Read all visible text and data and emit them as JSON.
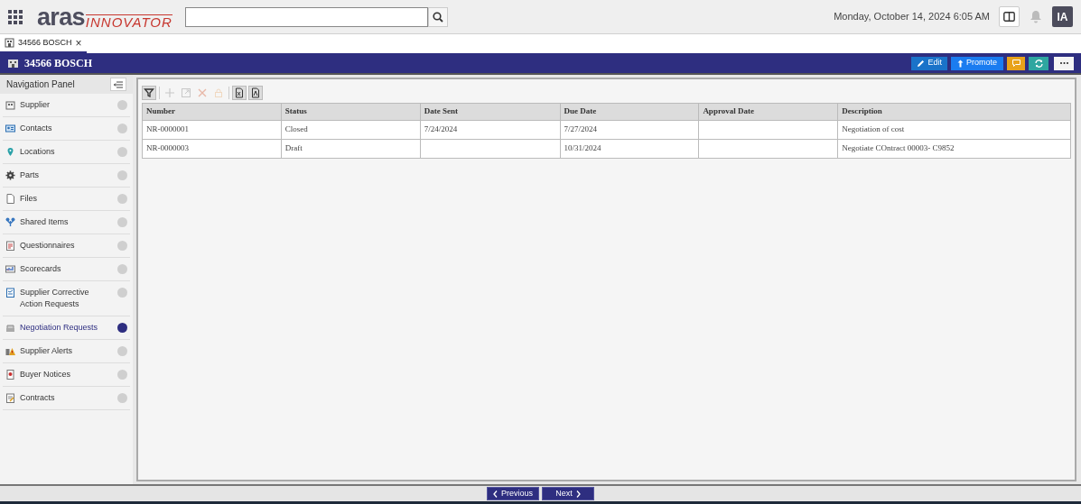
{
  "header": {
    "logo_main": "aras",
    "logo_sub": "INNOVATOR",
    "datetime": "Monday, October 14, 2024 6:05 AM",
    "avatar": "IA"
  },
  "tabs": [
    {
      "label": "34566 BOSCH",
      "selected": true,
      "close": "×"
    }
  ],
  "item_bar": {
    "title": "34566 BOSCH",
    "buttons": [
      {
        "kind": "edit",
        "label": "Edit"
      },
      {
        "kind": "promote",
        "label": "Promote"
      },
      {
        "kind": "comment"
      },
      {
        "kind": "refresh"
      },
      {
        "kind": "more"
      }
    ]
  },
  "navigation": {
    "title": "Navigation Panel",
    "items": [
      {
        "label": "Supplier",
        "selected": false
      },
      {
        "label": "Contacts",
        "selected": false
      },
      {
        "label": "Locations",
        "selected": false
      },
      {
        "label": "Parts",
        "selected": false
      },
      {
        "label": "Files",
        "selected": false
      },
      {
        "label": "Shared Items",
        "selected": false
      },
      {
        "label": "Questionnaires",
        "selected": false
      },
      {
        "label": "Scorecards",
        "selected": false
      },
      {
        "label": "Supplier Corrective Action Requests",
        "selected": false
      },
      {
        "label": "Negotiation Requests",
        "selected": true
      },
      {
        "label": "Supplier Alerts",
        "selected": false
      },
      {
        "label": "Buyer Notices",
        "selected": false
      },
      {
        "label": "Contracts",
        "selected": false
      }
    ]
  },
  "toolbar": [
    {
      "kind": "filter",
      "disabled": false
    },
    {
      "kind": "add",
      "disabled": true
    },
    {
      "kind": "open",
      "disabled": true
    },
    {
      "kind": "delete",
      "disabled": true
    },
    {
      "kind": "lock",
      "disabled": true
    },
    {
      "kind": "excel",
      "disabled": false
    },
    {
      "kind": "pdf",
      "disabled": false
    }
  ],
  "table": {
    "columns": [
      "Number",
      "Status",
      "Date Sent",
      "Due Date",
      "Approval Date",
      "Description"
    ],
    "rows": [
      [
        "NR-0000001",
        "Closed",
        "7/24/2024",
        "7/27/2024",
        "",
        "Negotiation of cost"
      ],
      [
        "NR-0000003",
        "Draft",
        "",
        "10/31/2024",
        "",
        "Negotiate COntract 00003- C9852"
      ]
    ]
  },
  "pager": {
    "previous": "Previous",
    "next": "Next"
  }
}
